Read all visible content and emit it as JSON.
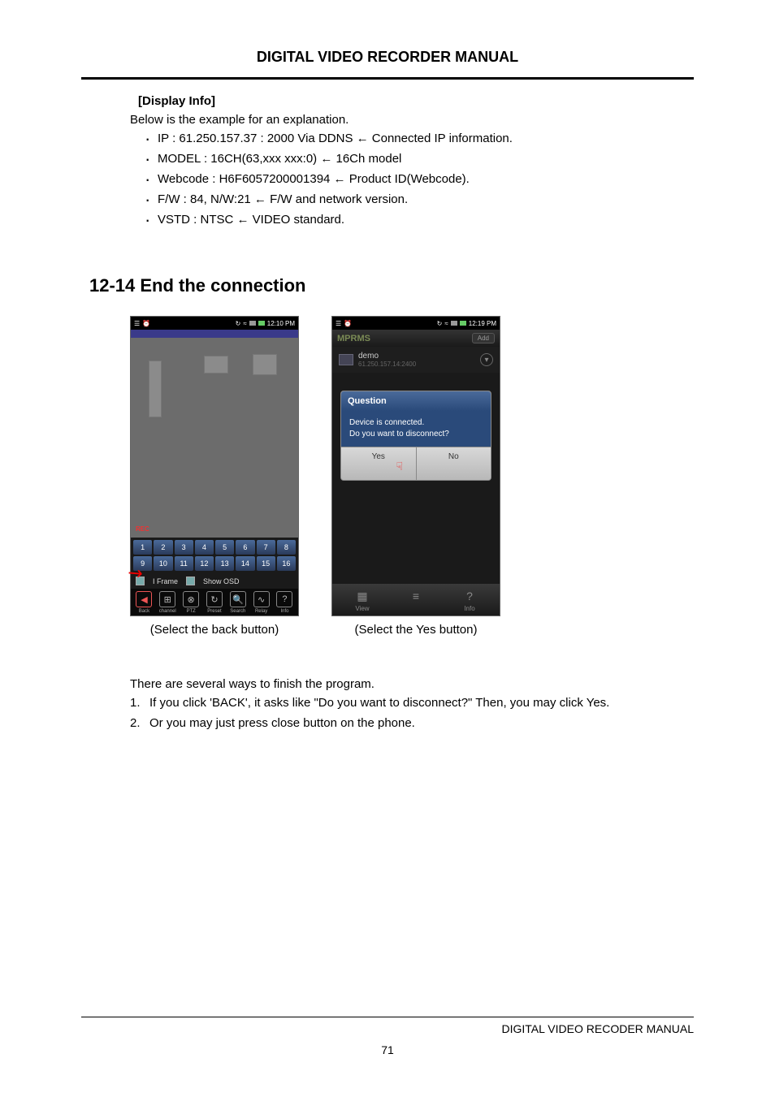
{
  "header": {
    "title": "DIGITAL VIDEO RECORDER MANUAL"
  },
  "display_info": {
    "heading": "[Display Info]",
    "intro": "Below is the example for an explanation.",
    "items": [
      "IP : 61.250.157.37 : 2000 Via DDNS ← Connected IP information.",
      "MODEL : 16CH(63,xxx xxx:0) ← 16Ch model",
      "Webcode : H6F6057200001394 ← Product ID(Webcode).",
      "F/W : 84, N/W:21 ← F/W and network version.",
      "VSTD : NTSC ← VIDEO standard."
    ]
  },
  "section": {
    "heading": "12-14 End the connection"
  },
  "screenshot_a": {
    "time": "12:10 PM",
    "rec": "REC",
    "channels": [
      "1",
      "2",
      "3",
      "4",
      "5",
      "6",
      "7",
      "8",
      "9",
      "10",
      "11",
      "12",
      "13",
      "14",
      "15",
      "16"
    ],
    "check1": "I Frame",
    "check2": "Show OSD",
    "toolbar": [
      {
        "label": "Back",
        "glyph": "◀"
      },
      {
        "label": "channel",
        "glyph": "⊞"
      },
      {
        "label": "PTZ",
        "glyph": "⊗"
      },
      {
        "label": "Preset",
        "glyph": "↻"
      },
      {
        "label": "Search",
        "glyph": "🔍"
      },
      {
        "label": "Relay",
        "glyph": "∿"
      },
      {
        "label": "Info",
        "glyph": "?"
      }
    ],
    "caption": "(Select the back button)"
  },
  "screenshot_b": {
    "time": "12:19 PM",
    "app_title": "MPRMS",
    "add": "Add",
    "device_name": "demo",
    "device_ip": "61.250.157.14:2400",
    "dialog_title": "Question",
    "dialog_line1": "Device is connected.",
    "dialog_line2": "Do you want to disconnect?",
    "yes": "Yes",
    "no": "No",
    "tabs": [
      {
        "label": "View",
        "glyph": "▦"
      },
      {
        "label": "",
        "glyph": "≡"
      },
      {
        "label": "Info",
        "glyph": "?"
      }
    ],
    "caption": "(Select the Yes button)"
  },
  "finish": {
    "intro": "There are several ways to finish the program.",
    "items": [
      "If you click 'BACK', it asks like \"Do you want to disconnect?\" Then, you may click Yes.",
      "Or you may just press close button on the phone."
    ]
  },
  "footer": {
    "text": "DIGITAL VIDEO RECODER MANUAL",
    "page": "71"
  }
}
